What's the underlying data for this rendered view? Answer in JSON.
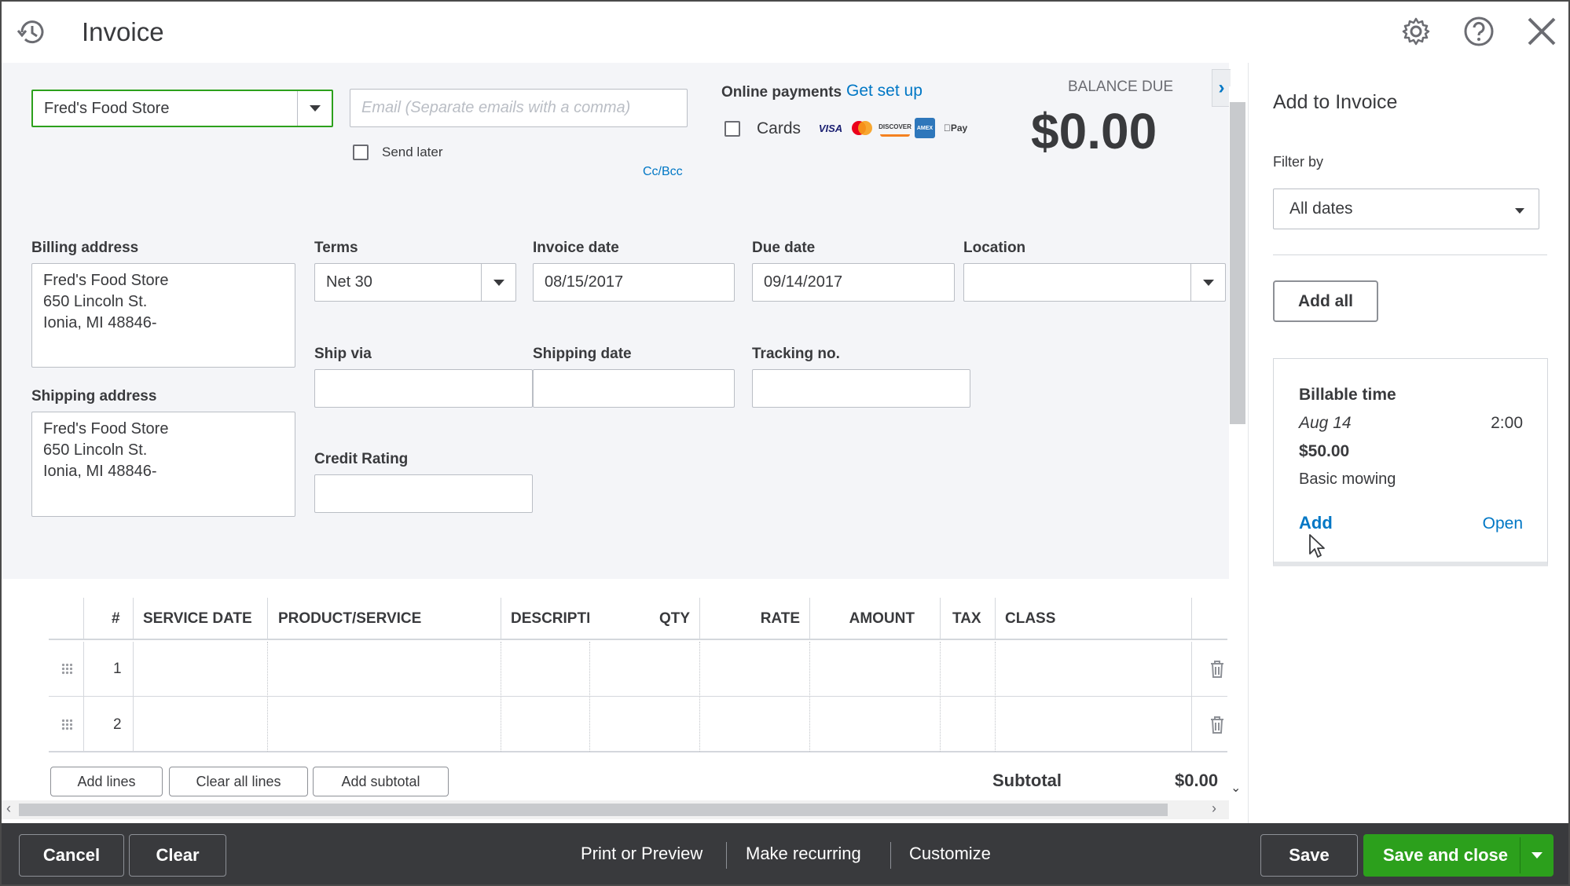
{
  "header": {
    "title": "Invoice",
    "icons": [
      "recent-history-icon",
      "gear-icon",
      "help-icon",
      "close-icon"
    ]
  },
  "customer": {
    "value": "Fred's Food Store",
    "email_placeholder": "Email (Separate emails with a comma)",
    "send_later_label": "Send later",
    "cc_bcc_label": "Cc/Bcc"
  },
  "online_payments": {
    "label": "Online payments",
    "setup_link": "Get set up",
    "cards_label": "Cards",
    "card_logos": [
      "VISA",
      "MC",
      "DISCOVER",
      "AMEX",
      "Pay"
    ]
  },
  "balance": {
    "label": "BALANCE DUE",
    "amount": "$0.00"
  },
  "fields": {
    "billing_address_label": "Billing address",
    "billing_address_lines": [
      "Fred's Food Store",
      "650 Lincoln St.",
      "Ionia, MI  48846-"
    ],
    "shipping_address_label": "Shipping address",
    "shipping_address_lines": [
      "Fred's Food Store",
      "650 Lincoln St.",
      "Ionia, MI  48846-"
    ],
    "terms_label": "Terms",
    "terms_value": "Net 30",
    "invoice_date_label": "Invoice date",
    "invoice_date_value": "08/15/2017",
    "due_date_label": "Due date",
    "due_date_value": "09/14/2017",
    "location_label": "Location",
    "location_value": "",
    "ship_via_label": "Ship via",
    "shipping_date_label": "Shipping date",
    "tracking_label": "Tracking no.",
    "credit_rating_label": "Credit Rating"
  },
  "table": {
    "columns": [
      "#",
      "SERVICE DATE",
      "PRODUCT/SERVICE",
      "DESCRIPTI",
      "QTY",
      "RATE",
      "AMOUNT",
      "TAX",
      "CLASS"
    ],
    "rows": [
      {
        "num": "1"
      },
      {
        "num": "2"
      }
    ],
    "add_lines_label": "Add lines",
    "clear_all_lines_label": "Clear all lines",
    "add_subtotal_label": "Add subtotal",
    "subtotal_label": "Subtotal",
    "subtotal_value": "$0.00"
  },
  "side_panel": {
    "title": "Add to Invoice",
    "filter_label": "Filter by",
    "filter_value": "All dates",
    "add_all_label": "Add all",
    "card": {
      "title": "Billable time",
      "date": "Aug 14",
      "duration": "2:00",
      "amount": "$50.00",
      "description": "Basic mowing",
      "add_label": "Add",
      "open_label": "Open"
    }
  },
  "footer": {
    "cancel_label": "Cancel",
    "clear_label": "Clear",
    "print_preview_label": "Print or Preview",
    "make_recurring_label": "Make recurring",
    "customize_label": "Customize",
    "save_label": "Save",
    "save_close_label": "Save and close"
  },
  "colors": {
    "accent_green": "#2ca01c",
    "link_blue": "#0077c5",
    "footer_bg": "#393a3d",
    "page_bg": "#f4f5f8"
  }
}
